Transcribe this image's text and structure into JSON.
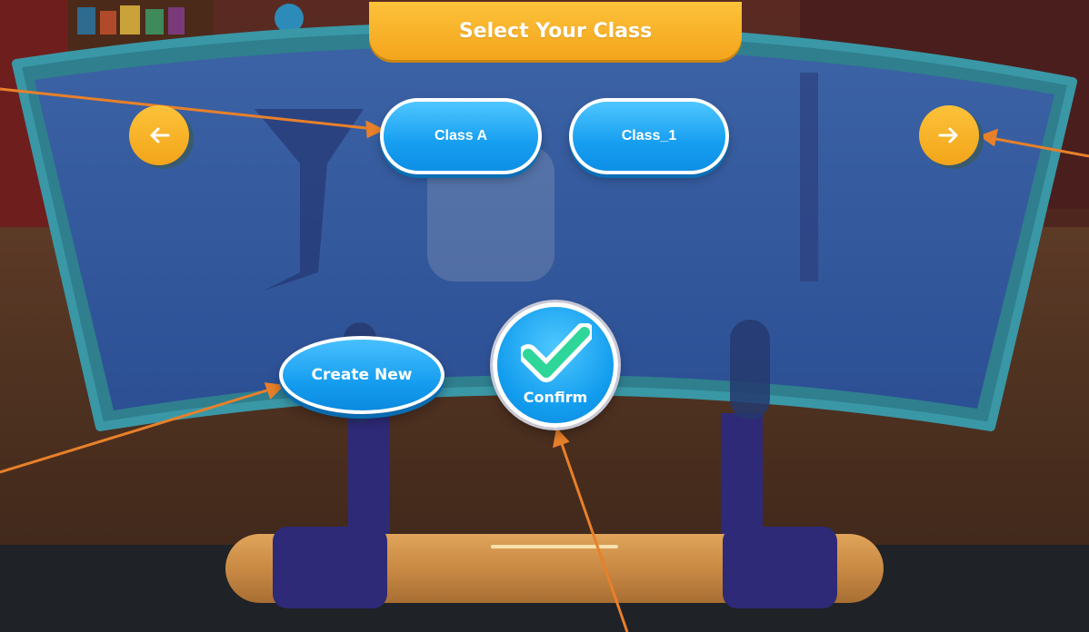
{
  "header": {
    "title": "Select Your Class"
  },
  "classes": [
    {
      "label": "Class A"
    },
    {
      "label": "Class_1"
    }
  ],
  "nav": {
    "prev_icon": "arrow-left-icon",
    "next_icon": "arrow-right-icon"
  },
  "actions": {
    "create_label": "Create New",
    "confirm_label": "Confirm",
    "confirm_icon": "checkmark-icon"
  },
  "colors": {
    "accent_yellow": "#f7b02a",
    "button_blue": "#169ef0",
    "annotation_arrow": "#e8802a",
    "check_green": "#2fd699"
  }
}
